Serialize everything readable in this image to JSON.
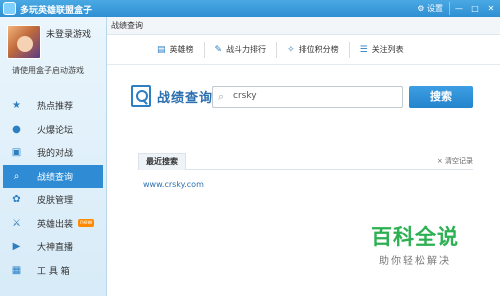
{
  "window": {
    "title": "多玩英雄联盟盒子",
    "controls": {
      "settings": "⚙ 设置",
      "minimize": "—",
      "maximize": "□",
      "close": "✕"
    }
  },
  "user": {
    "name": "未登录游戏",
    "hint": "请使用盒子启动游戏"
  },
  "sidebar": {
    "items": [
      {
        "label": "热点推荐",
        "icon": "★"
      },
      {
        "label": "火爆论坛",
        "icon": "●"
      },
      {
        "label": "我的对战",
        "icon": "▣"
      },
      {
        "label": "战绩查询",
        "icon": "⌕"
      },
      {
        "label": "皮肤管理",
        "icon": "✿"
      },
      {
        "label": "英雄出装",
        "icon": "⚔",
        "badge": "new"
      },
      {
        "label": "大神直播",
        "icon": "▶"
      },
      {
        "label": "工 具 箱",
        "icon": "▦"
      }
    ]
  },
  "breadcrumb": "战绩查询",
  "tabs": [
    {
      "label": "英雄榜",
      "icon": "▤"
    },
    {
      "label": "战斗力排行",
      "icon": "✎"
    },
    {
      "label": "排位积分榜",
      "icon": "✧"
    },
    {
      "label": "关注列表",
      "icon": "☰"
    }
  ],
  "search": {
    "title": "战绩查询",
    "value": "crsky",
    "button": "搜索"
  },
  "recent": {
    "tab_label": "最近搜索",
    "clear_label": "× 清空记录",
    "items": [
      "www.crsky.com"
    ]
  },
  "watermark": {
    "title": "百科全说",
    "subtitle": "助你轻松解决"
  }
}
